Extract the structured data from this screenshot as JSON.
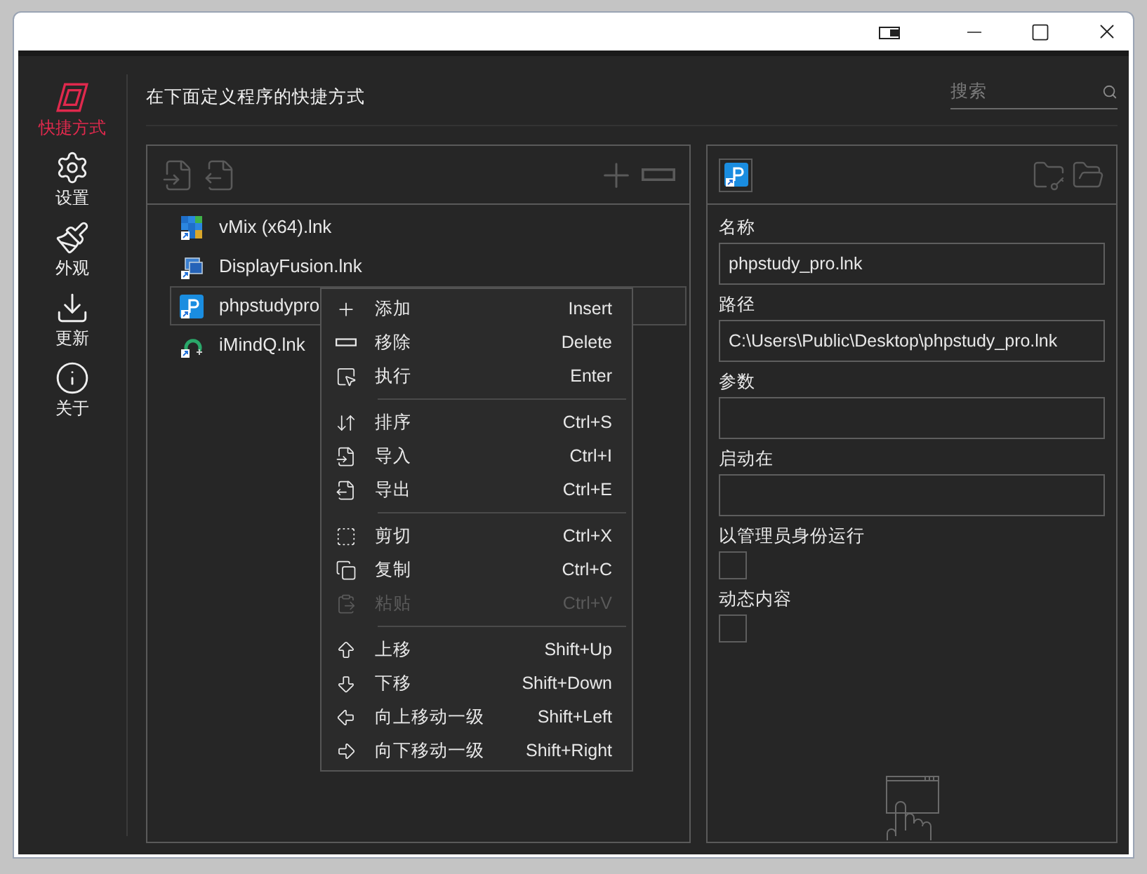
{
  "sidebar": {
    "items": [
      {
        "label": "快捷方式",
        "selected": true
      },
      {
        "label": "设置",
        "selected": false
      },
      {
        "label": "外观",
        "selected": false
      },
      {
        "label": "更新",
        "selected": false
      },
      {
        "label": "关于",
        "selected": false
      }
    ]
  },
  "header": {
    "title": "在下面定义程序的快捷方式"
  },
  "search": {
    "placeholder": "搜索"
  },
  "shortcuts": {
    "items": [
      {
        "name": "vMix (x64).lnk",
        "selected": false
      },
      {
        "name": "DisplayFusion.lnk",
        "selected": false
      },
      {
        "name": "phpstudypro",
        "selected": true
      },
      {
        "name": "iMindQ.lnk",
        "selected": false
      }
    ]
  },
  "context_menu": {
    "groups": [
      [
        {
          "label": "添加",
          "shortcut": "Insert",
          "disabled": false
        },
        {
          "label": "移除",
          "shortcut": "Delete",
          "disabled": false
        },
        {
          "label": "执行",
          "shortcut": "Enter",
          "disabled": false
        }
      ],
      [
        {
          "label": "排序",
          "shortcut": "Ctrl+S",
          "disabled": false
        },
        {
          "label": "导入",
          "shortcut": "Ctrl+I",
          "disabled": false
        },
        {
          "label": "导出",
          "shortcut": "Ctrl+E",
          "disabled": false
        }
      ],
      [
        {
          "label": "剪切",
          "shortcut": "Ctrl+X",
          "disabled": false
        },
        {
          "label": "复制",
          "shortcut": "Ctrl+C",
          "disabled": false
        },
        {
          "label": "粘贴",
          "shortcut": "Ctrl+V",
          "disabled": true
        }
      ],
      [
        {
          "label": "上移",
          "shortcut": "Shift+Up",
          "disabled": false
        },
        {
          "label": "下移",
          "shortcut": "Shift+Down",
          "disabled": false
        },
        {
          "label": "向上移动一级",
          "shortcut": "Shift+Left",
          "disabled": false
        },
        {
          "label": "向下移动一级",
          "shortcut": "Shift+Right",
          "disabled": false
        }
      ]
    ]
  },
  "details": {
    "fields": [
      {
        "kind": "text",
        "label": "名称",
        "value": "phpstudy_pro.lnk"
      },
      {
        "kind": "text",
        "label": "路径",
        "value": "C:\\Users\\Public\\Desktop\\phpstudy_pro.lnk"
      },
      {
        "kind": "text",
        "label": "参数"
      },
      {
        "kind": "text",
        "label": "启动在"
      },
      {
        "kind": "checkbox",
        "label": "以管理员身份运行",
        "checked": false
      },
      {
        "kind": "checkbox",
        "label": "动态内容",
        "checked": false
      }
    ]
  }
}
